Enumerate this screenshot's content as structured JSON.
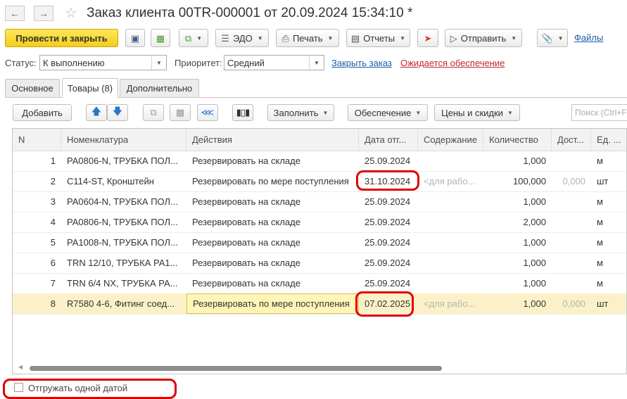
{
  "header": {
    "title": "Заказ клиента 00TR-000001 от 20.09.2024 15:34:10 *",
    "back_icon": "arrow-left-icon",
    "forward_icon": "arrow-right-icon",
    "favorite_icon": "star-icon"
  },
  "commandbar": {
    "post_close": "Провести и закрыть",
    "edo": "ЭДО",
    "print": "Печать",
    "reports": "Отчеты",
    "send": "Отправить",
    "files": "Файлы"
  },
  "status": {
    "status_label": "Статус:",
    "status_value": "К выполнению",
    "priority_label": "Приоритет:",
    "priority_value": "Средний",
    "close_order": "Закрыть заказ",
    "awaiting": "Ожидается обеспечение"
  },
  "tabs": [
    {
      "label": "Основное"
    },
    {
      "label": "Товары (8)"
    },
    {
      "label": "Дополнительно"
    }
  ],
  "table_toolbar": {
    "add": "Добавить",
    "fill": "Заполнить",
    "provision": "Обеспечение",
    "prices": "Цены и скидки",
    "search_placeholder": "Поиск (Ctrl+F)"
  },
  "table": {
    "columns": [
      "N",
      "Номенклатура",
      "Действия",
      "Дата отг...",
      "Содержание",
      "Количество",
      "Дост...",
      "Ед. ..."
    ],
    "rows": [
      {
        "n": "1",
        "item": "PA0806-N, ТРУБКА ПОЛ...",
        "action": "Резервировать на складе",
        "date": "25.09.2024",
        "content": "",
        "qty": "1,000",
        "avail": "",
        "unit": "м"
      },
      {
        "n": "2",
        "item": "C114-ST, Кронштейн",
        "action": "Резервировать по мере поступления",
        "date": "31.10.2024",
        "content": "<для рабо...",
        "qty": "100,000",
        "avail": "0,000",
        "unit": "шт"
      },
      {
        "n": "3",
        "item": "PA0604-N, ТРУБКА ПОЛ...",
        "action": "Резервировать на складе",
        "date": "25.09.2024",
        "content": "",
        "qty": "1,000",
        "avail": "",
        "unit": "м"
      },
      {
        "n": "4",
        "item": "PA0806-N, ТРУБКА ПОЛ...",
        "action": "Резервировать на складе",
        "date": "25.09.2024",
        "content": "",
        "qty": "2,000",
        "avail": "",
        "unit": "м"
      },
      {
        "n": "5",
        "item": "PA1008-N, ТРУБКА ПОЛ...",
        "action": "Резервировать на складе",
        "date": "25.09.2024",
        "content": "",
        "qty": "1,000",
        "avail": "",
        "unit": "м"
      },
      {
        "n": "6",
        "item": "TRN 12/10, ТРУБКА PA1...",
        "action": "Резервировать на складе",
        "date": "25.09.2024",
        "content": "",
        "qty": "1,000",
        "avail": "",
        "unit": "м"
      },
      {
        "n": "7",
        "item": "TRN 6/4 NX, ТРУБКА PA...",
        "action": "Резервировать на складе",
        "date": "25.09.2024",
        "content": "",
        "qty": "1,000",
        "avail": "",
        "unit": "м"
      },
      {
        "n": "8",
        "item": "R7580 4-6, Фитинг соед...",
        "action": "Резервировать по мере поступления",
        "date": "07.02.2025",
        "content": "<для рабо...",
        "qty": "1,000",
        "avail": "0,000",
        "unit": "шт"
      }
    ]
  },
  "footer": {
    "ship_one_date": "Отгружать одной датой"
  },
  "colors": {
    "primary_button": "#f4cd1a",
    "link": "#1c5fa8",
    "link_warning": "#c0282d",
    "annotation": "#e00000",
    "selected_row": "#fbf1c8"
  }
}
